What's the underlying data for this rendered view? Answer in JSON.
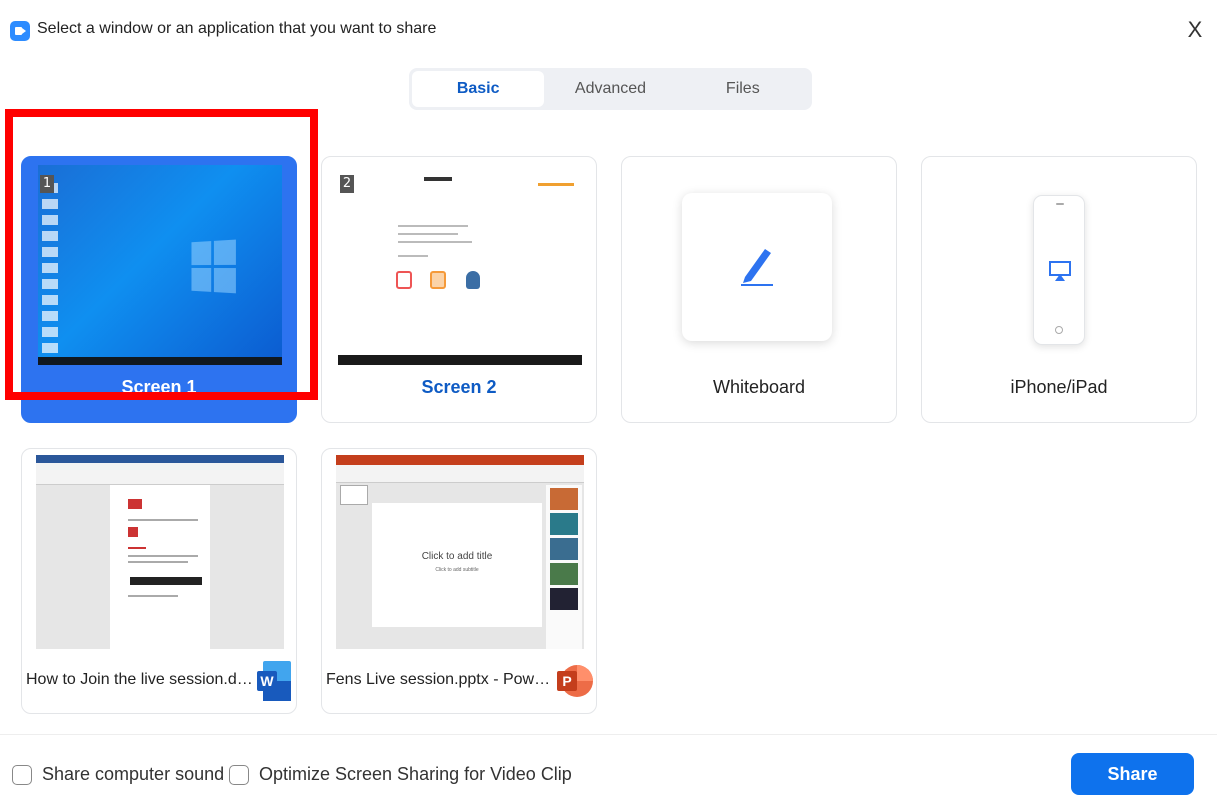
{
  "window": {
    "title": "Select a window or an application that you want to share",
    "close_label": "X"
  },
  "tabs": [
    {
      "label": "Basic",
      "active": true
    },
    {
      "label": "Advanced",
      "active": false
    },
    {
      "label": "Files",
      "active": false
    }
  ],
  "sources": {
    "screen1": {
      "label": "Screen 1",
      "badge": "1",
      "selected": true
    },
    "screen2": {
      "label": "Screen 2",
      "badge": "2",
      "selected": false
    },
    "whiteboard": {
      "label": "Whiteboard"
    },
    "iphone": {
      "label": "iPhone/iPad"
    }
  },
  "windows": [
    {
      "name": "How to Join the live session.docx...",
      "app": "W",
      "app_icon": "word-icon"
    },
    {
      "name": "Fens Live session.pptx - PowerPo...",
      "app": "P",
      "app_icon": "powerpoint-icon",
      "slide_title": "Click to add title",
      "slide_subtitle": "Click to add subtitle"
    }
  ],
  "footer": {
    "share_sound_label": "Share computer sound",
    "optimize_label": "Optimize Screen Sharing for Video Clip",
    "share_button": "Share"
  },
  "colors": {
    "accent": "#0e72ed",
    "selected_card": "#2d73f0",
    "highlight": "#ff0000"
  }
}
